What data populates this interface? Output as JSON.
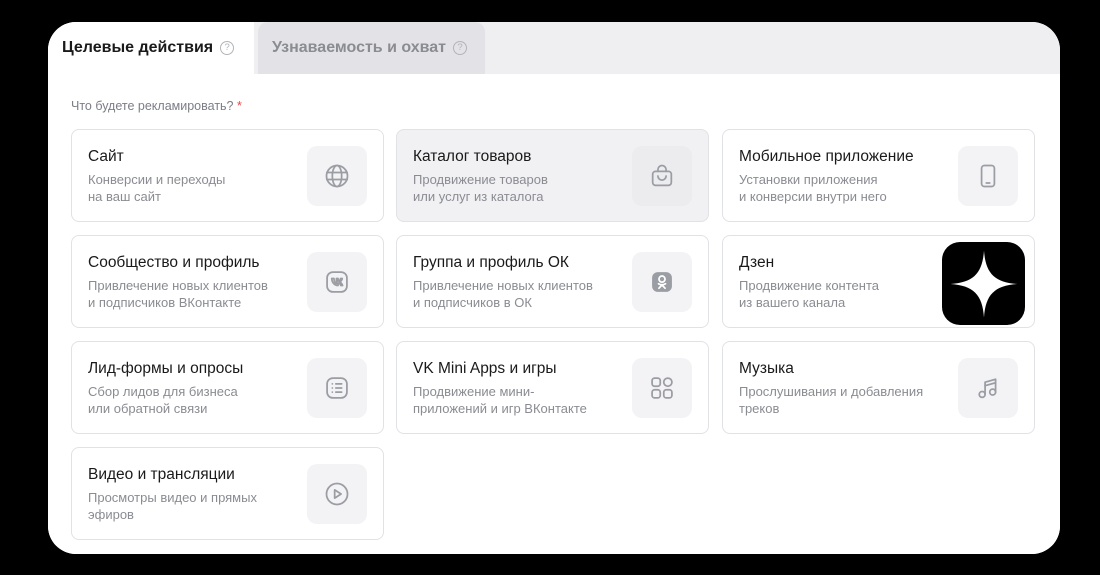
{
  "tabs": [
    {
      "label": "Целевые действия",
      "help": "?",
      "active": true
    },
    {
      "label": "Узнаваемость и охват",
      "help": "?",
      "active": false
    }
  ],
  "question": {
    "label": "Что будете рекламировать?",
    "required_mark": "*"
  },
  "options": [
    {
      "title": "Сайт",
      "desc": [
        "Конверсии и переходы",
        "на ваш сайт"
      ],
      "icon": "globe-icon"
    },
    {
      "title": "Каталог товаров",
      "desc": [
        "Продвижение товаров",
        "или услуг из каталога"
      ],
      "icon": "shopping-bag-icon",
      "selected": true
    },
    {
      "title": "Мобильное приложение",
      "desc": [
        "Установки приложения",
        "и конверсии внутри него"
      ],
      "icon": "smartphone-icon"
    },
    {
      "title": "Сообщество и профиль",
      "desc": [
        "Привлечение новых клиентов",
        "и подписчиков ВКонтакте"
      ],
      "icon": "vk-icon"
    },
    {
      "title": "Группа и профиль ОК",
      "desc": [
        "Привлечение новых клиентов",
        "и подписчиков в ОК"
      ],
      "icon": "ok-icon"
    },
    {
      "title": "Дзен",
      "desc": [
        "Продвижение контента",
        "из вашего канала"
      ],
      "icon": "dzen-logo-icon"
    },
    {
      "title": "Лид-формы и опросы",
      "desc": [
        "Сбор лидов для бизнеса",
        "или обратной связи"
      ],
      "icon": "list-form-icon"
    },
    {
      "title": "VK Mini Apps и игры",
      "desc": [
        "Продвижение мини-",
        "приложений и игр ВКонтакте"
      ],
      "icon": "apps-grid-icon"
    },
    {
      "title": "Музыка",
      "desc": [
        "Прослушивания и добавления",
        "треков"
      ],
      "icon": "music-note-icon"
    },
    {
      "title": "Видео и трансляции",
      "desc": [
        "Просмотры видео и прямых",
        "эфиров"
      ],
      "icon": "play-circle-icon"
    }
  ],
  "colors": {
    "accent_required": "#e64646",
    "card_border": "#e1e2e5",
    "selected_bg": "#f1f1f3",
    "dzen_logo": "#000000"
  }
}
